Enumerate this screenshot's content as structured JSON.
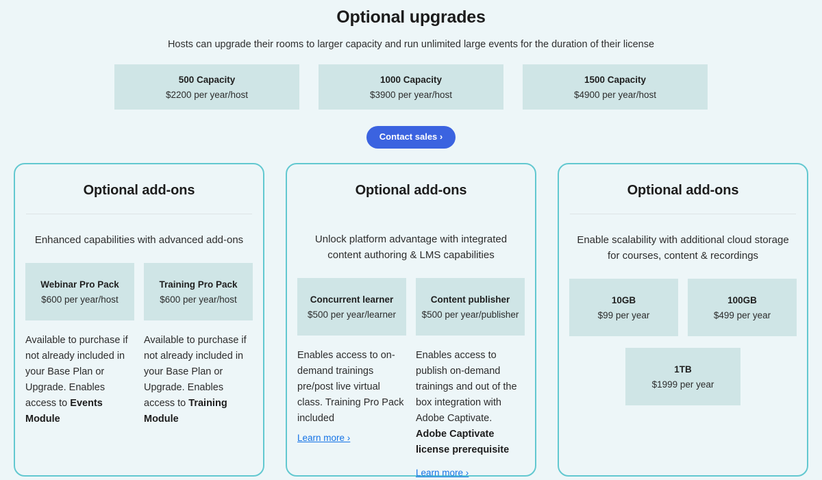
{
  "header": {
    "title": "Optional upgrades",
    "subtitle": "Hosts can upgrade their rooms to larger capacity and run unlimited large events for the duration of their license"
  },
  "capacity_options": [
    {
      "name": "500 Capacity",
      "price": "$2200 per year/host"
    },
    {
      "name": "1000 Capacity",
      "price": "$3900 per year/host"
    },
    {
      "name": "1500 Capacity",
      "price": "$4900 per year/host"
    }
  ],
  "cta": {
    "label": "Contact sales ›"
  },
  "cards": [
    {
      "title": "Optional add-ons",
      "description": "Enhanced capabilities with advanced add-ons",
      "addons_row1": [
        {
          "name": "Webinar Pro Pack",
          "price": "$600 per year/host"
        },
        {
          "name": "Training Pro Pack",
          "price": "$600 per year/host"
        }
      ],
      "notes": [
        {
          "text_plain": "Available to purchase if not already included in your Base Plan or Upgrade. Enables access to ",
          "text_bold": "Events Module",
          "link": null
        },
        {
          "text_plain": "Available to purchase if not already included in your Base Plan or Upgrade. Enables access to ",
          "text_bold": "Training Module",
          "link": null
        }
      ]
    },
    {
      "title": "Optional add-ons",
      "description": "Unlock platform advantage with integrated content authoring & LMS capabilities",
      "addons_row1": [
        {
          "name": "Concurrent learner",
          "price": "$500 per year/learner"
        },
        {
          "name": "Content publisher",
          "price": "$500 per year/publisher"
        }
      ],
      "notes": [
        {
          "text_plain": "Enables access to on-demand trainings pre/post live virtual class. Training Pro Pack included",
          "text_bold": "",
          "link": "Learn more ›"
        },
        {
          "text_plain": "Enables access to publish on-demand trainings and out of the box integration with Adobe Captivate. ",
          "text_bold": "Adobe Captivate license prerequisite",
          "link": "Learn more ›"
        }
      ]
    },
    {
      "title": "Optional add-ons",
      "description": "Enable scalability with additional cloud storage for courses, content & recordings",
      "addons_row1": [
        {
          "name": "10GB",
          "price": "$99 per year"
        },
        {
          "name": "100GB",
          "price": "$499 per year"
        }
      ],
      "addons_row2": [
        {
          "name": "1TB",
          "price": "$1999 per year"
        }
      ],
      "notes": []
    }
  ],
  "colors": {
    "page_background": "#EDF6F8",
    "card_border": "#62C8D0",
    "addon_fill": "#CFE5E6",
    "cta_blue": "#3B63E0",
    "link_blue": "#1473E6",
    "divider": "#DDE4E6"
  }
}
